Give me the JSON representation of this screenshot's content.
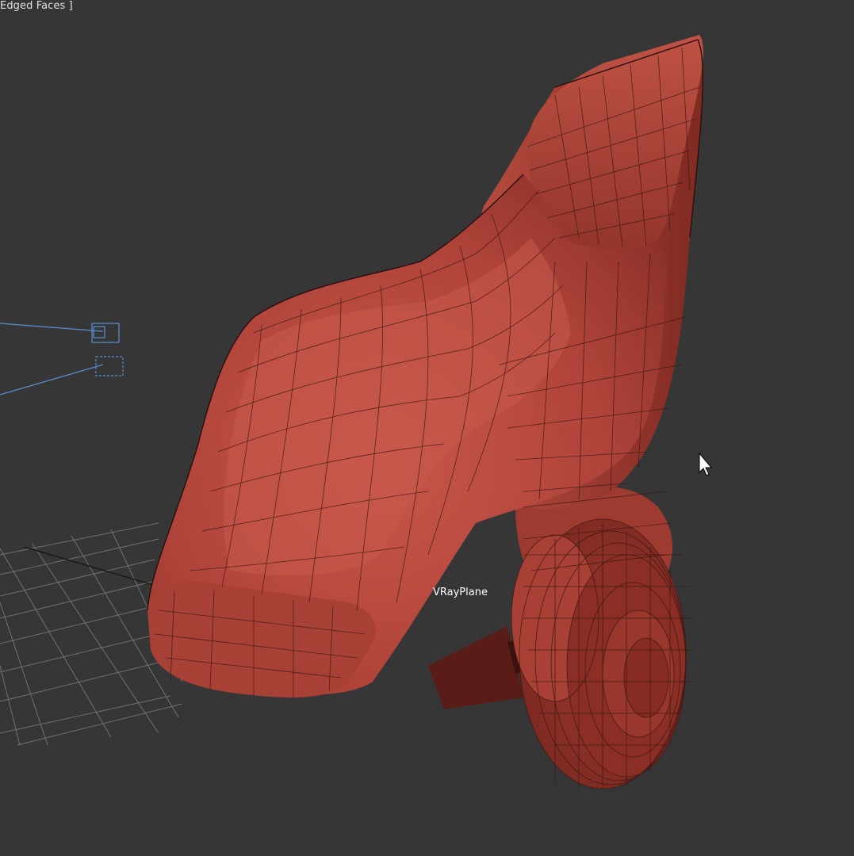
{
  "viewport": {
    "shading_mode_label": "Edged Faces ]",
    "object_label": "VRayPlane",
    "background_color": "#363636",
    "model_color": "#b8483c",
    "wire_color": "#3a1612",
    "helper_color": "#5b8fd0",
    "grid_color": "#8a8a8a"
  },
  "cursor": {
    "icon": "mouse-pointer-icon"
  }
}
